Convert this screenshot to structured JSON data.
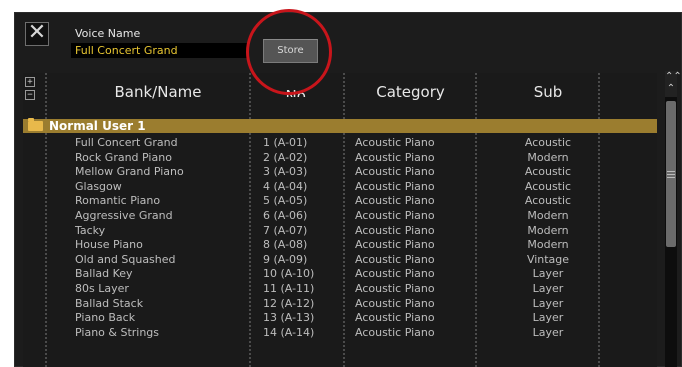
{
  "header": {
    "close_glyph": "✕",
    "voice_name_label": "Voice Name",
    "voice_name_value": "Full Concert Grand",
    "store_label": "Store"
  },
  "list": {
    "expand_glyph": "+",
    "collapse_glyph": "−",
    "columns": {
      "bank_name": "Bank/Name",
      "no": "No.",
      "category": "Category",
      "sub": "Sub"
    },
    "group": "Normal User 1",
    "rows": [
      {
        "name": "Full Concert Grand",
        "no": "1 (A-01)",
        "category": "Acoustic Piano",
        "sub": "Acoustic"
      },
      {
        "name": "Rock Grand Piano",
        "no": "2 (A-02)",
        "category": "Acoustic Piano",
        "sub": "Modern"
      },
      {
        "name": "Mellow Grand Piano",
        "no": "3 (A-03)",
        "category": "Acoustic Piano",
        "sub": "Acoustic"
      },
      {
        "name": "Glasgow",
        "no": "4 (A-04)",
        "category": "Acoustic Piano",
        "sub": "Acoustic"
      },
      {
        "name": "Romantic Piano",
        "no": "5 (A-05)",
        "category": "Acoustic Piano",
        "sub": "Acoustic"
      },
      {
        "name": "Aggressive Grand",
        "no": "6 (A-06)",
        "category": "Acoustic Piano",
        "sub": "Modern"
      },
      {
        "name": "Tacky",
        "no": "7 (A-07)",
        "category": "Acoustic Piano",
        "sub": "Modern"
      },
      {
        "name": "House Piano",
        "no": "8 (A-08)",
        "category": "Acoustic Piano",
        "sub": "Modern"
      },
      {
        "name": "Old and Squashed",
        "no": "9 (A-09)",
        "category": "Acoustic Piano",
        "sub": "Vintage"
      },
      {
        "name": "Ballad Key",
        "no": "10 (A-10)",
        "category": "Acoustic Piano",
        "sub": "Layer"
      },
      {
        "name": "80s Layer",
        "no": "11 (A-11)",
        "category": "Acoustic Piano",
        "sub": "Layer"
      },
      {
        "name": "Ballad Stack",
        "no": "12 (A-12)",
        "category": "Acoustic Piano",
        "sub": "Layer"
      },
      {
        "name": "Piano Back",
        "no": "13 (A-13)",
        "category": "Acoustic Piano",
        "sub": "Layer"
      },
      {
        "name": "Piano & Strings",
        "no": "14 (A-14)",
        "category": "Acoustic Piano",
        "sub": "Layer"
      }
    ]
  },
  "scrollbar": {
    "top_glyph": "⌃⌃",
    "up_glyph": "⌃"
  },
  "colors": {
    "group_row": "#9b7d2f",
    "voice_name_text": "#e7c531",
    "highlight_circle": "#c8151b"
  }
}
